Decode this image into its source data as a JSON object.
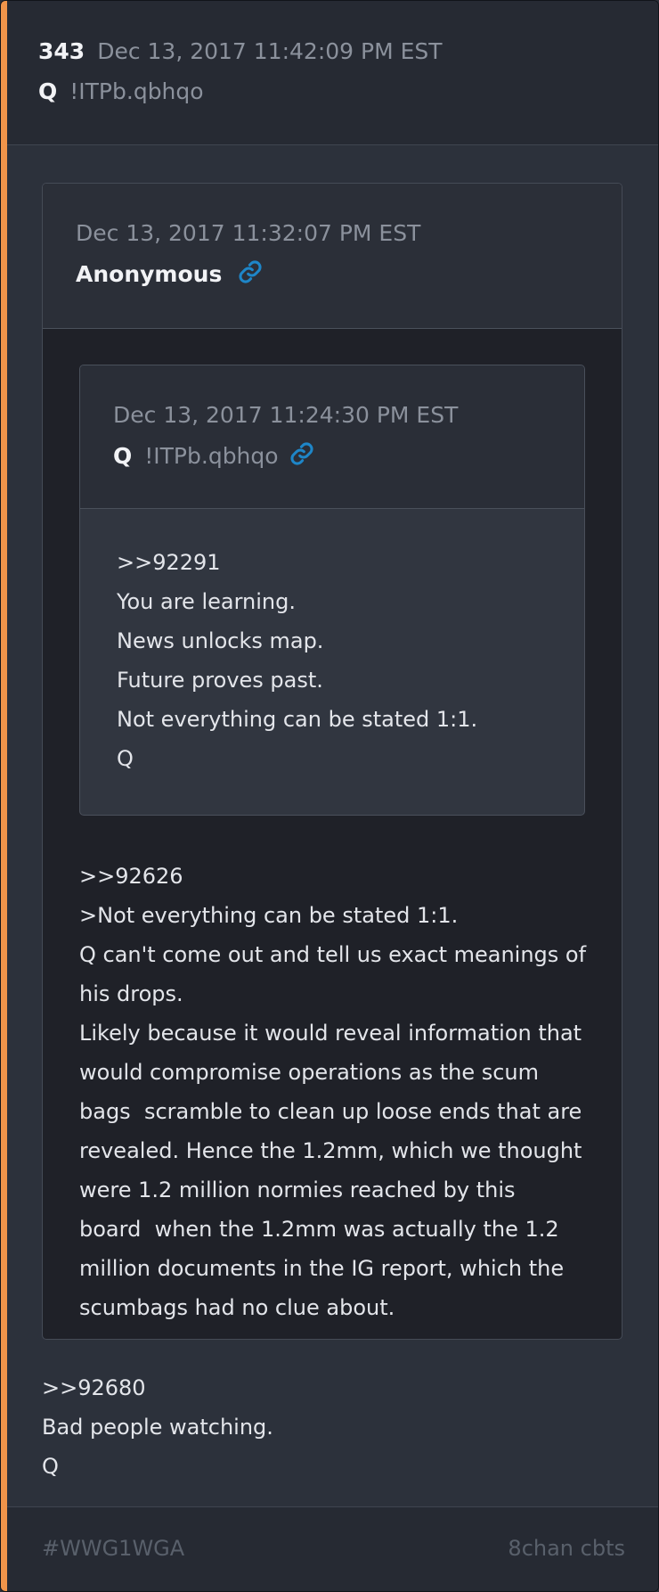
{
  "post": {
    "number": "343",
    "date": "Dec 13, 2017 11:42:09 PM EST",
    "author": "Q",
    "tripcode": "!ITPb.qbhqo",
    "accent_color": "#f0944a"
  },
  "quote1": {
    "date": "Dec 13, 2017 11:32:07 PM EST",
    "author": "Anonymous",
    "link_icon": "link-icon",
    "lines": [
      ">>92626",
      ">Not everything can be stated 1:1.",
      "Q can't come out and tell us exact meanings of",
      "his drops.",
      "Likely because it would reveal information that",
      "would compromise operations as the scum",
      "bags  scramble to clean up loose ends that are",
      "revealed. Hence the 1.2mm, which we thought",
      "were 1.2 million normies reached by this",
      "board  when the 1.2mm was actually the 1.2",
      "million documents in the IG report, which the",
      "scumbags had no clue about."
    ]
  },
  "quote2": {
    "date": "Dec 13, 2017 11:24:30 PM EST",
    "author": "Q",
    "tripcode": "!ITPb.qbhqo",
    "link_icon": "link-icon",
    "lines": [
      ">>92291",
      "You are learning.",
      "News unlocks map.",
      "Future proves past.",
      "Not everything can be stated 1:1.",
      "Q"
    ]
  },
  "body": {
    "lines": [
      ">>92680",
      "Bad people watching.",
      "Q"
    ]
  },
  "footer": {
    "hashtag": "#WWG1WGA",
    "source": "8chan cbts"
  },
  "colors": {
    "link": "#1e86c8",
    "muted": "#8b919c"
  }
}
